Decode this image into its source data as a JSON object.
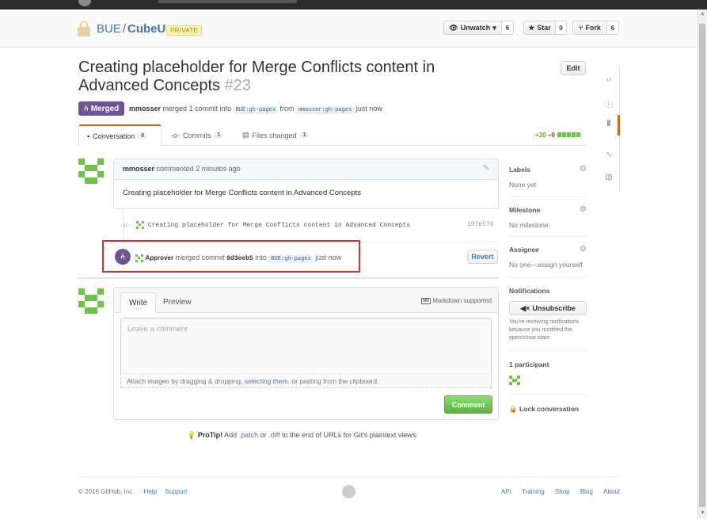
{
  "repo": {
    "owner": "BUE",
    "separator": "/",
    "name": "CubeU",
    "visibility": "PRIVATE"
  },
  "repo_actions": {
    "watch_label": "Unwatch",
    "watch_count": "6",
    "star_label": "Star",
    "star_count": "0",
    "fork_label": "Fork",
    "fork_count": "6"
  },
  "pr": {
    "title": "Creating placeholder for Merge Conflicts content in Advanced Concepts",
    "number": "#23",
    "edit_label": "Edit",
    "state": "Merged",
    "author": "mmosser",
    "meta_merged": "merged 1 commit into",
    "base_branch": "BUE:gh-pages",
    "meta_from": "from",
    "head_branch": "mmosser:gh-pages",
    "meta_time": "just now"
  },
  "tabs": [
    {
      "label": "Conversation",
      "count": "0"
    },
    {
      "label": "Commits",
      "count": "1"
    },
    {
      "label": "Files changed",
      "count": "1"
    }
  ],
  "diffstat": {
    "additions": "+30",
    "deletions": "−0"
  },
  "comment": {
    "author": "mmosser",
    "action": "commented 2 minutes ago",
    "body": "Creating placeholder for Merge Conflicts content in Advanced Concepts"
  },
  "commit": {
    "message": "Creating placeholder for Merge Conflicts content in Advanced Concepts",
    "sha": "197e576"
  },
  "merge_event": {
    "actor": "Approver",
    "action": "merged commit",
    "sha": "0d3eeb5",
    "into": "into",
    "branch": "BUE:gh-pages",
    "time": "just now",
    "revert_label": "Revert"
  },
  "new_comment": {
    "write_tab": "Write",
    "preview_tab": "Preview",
    "markdown_hint": "Markdown supported",
    "markdown_icon": "MD",
    "placeholder": "Leave a comment",
    "attach_pre": "Attach images by dragging & dropping,",
    "attach_link": "selecting them",
    "attach_post": ", or pasting from the clipboard.",
    "submit_label": "Comment"
  },
  "protip": {
    "label": "ProTip!",
    "pre": "Add",
    "patch": ".patch",
    "or": "or",
    "diff": ".diff",
    "post": "to the end of URLs for Git's plaintext views."
  },
  "sidebar": {
    "labels_title": "Labels",
    "labels_value": "None yet",
    "milestone_title": "Milestone",
    "milestone_value": "No milestone",
    "assignee_title": "Assignee",
    "assignee_value": "No one—assign yourself",
    "notifications_title": "Notifications",
    "unsubscribe_label": "Unsubscribe",
    "notifications_note": "You're receiving notifications because you modified the open/close state.",
    "participants_title": "1 participant",
    "lock_label": "Lock conversation"
  },
  "footer": {
    "copyright": "© 2016 GitHub, Inc.",
    "help": "Help",
    "support": "Support",
    "links": [
      "API",
      "Training",
      "Shop",
      "Blog",
      "About"
    ]
  },
  "colors": {
    "merged": "#6e5494",
    "link": "#4078c0",
    "accent": "#d26911",
    "success": "#6cc644",
    "highlight": "#d9302c"
  }
}
